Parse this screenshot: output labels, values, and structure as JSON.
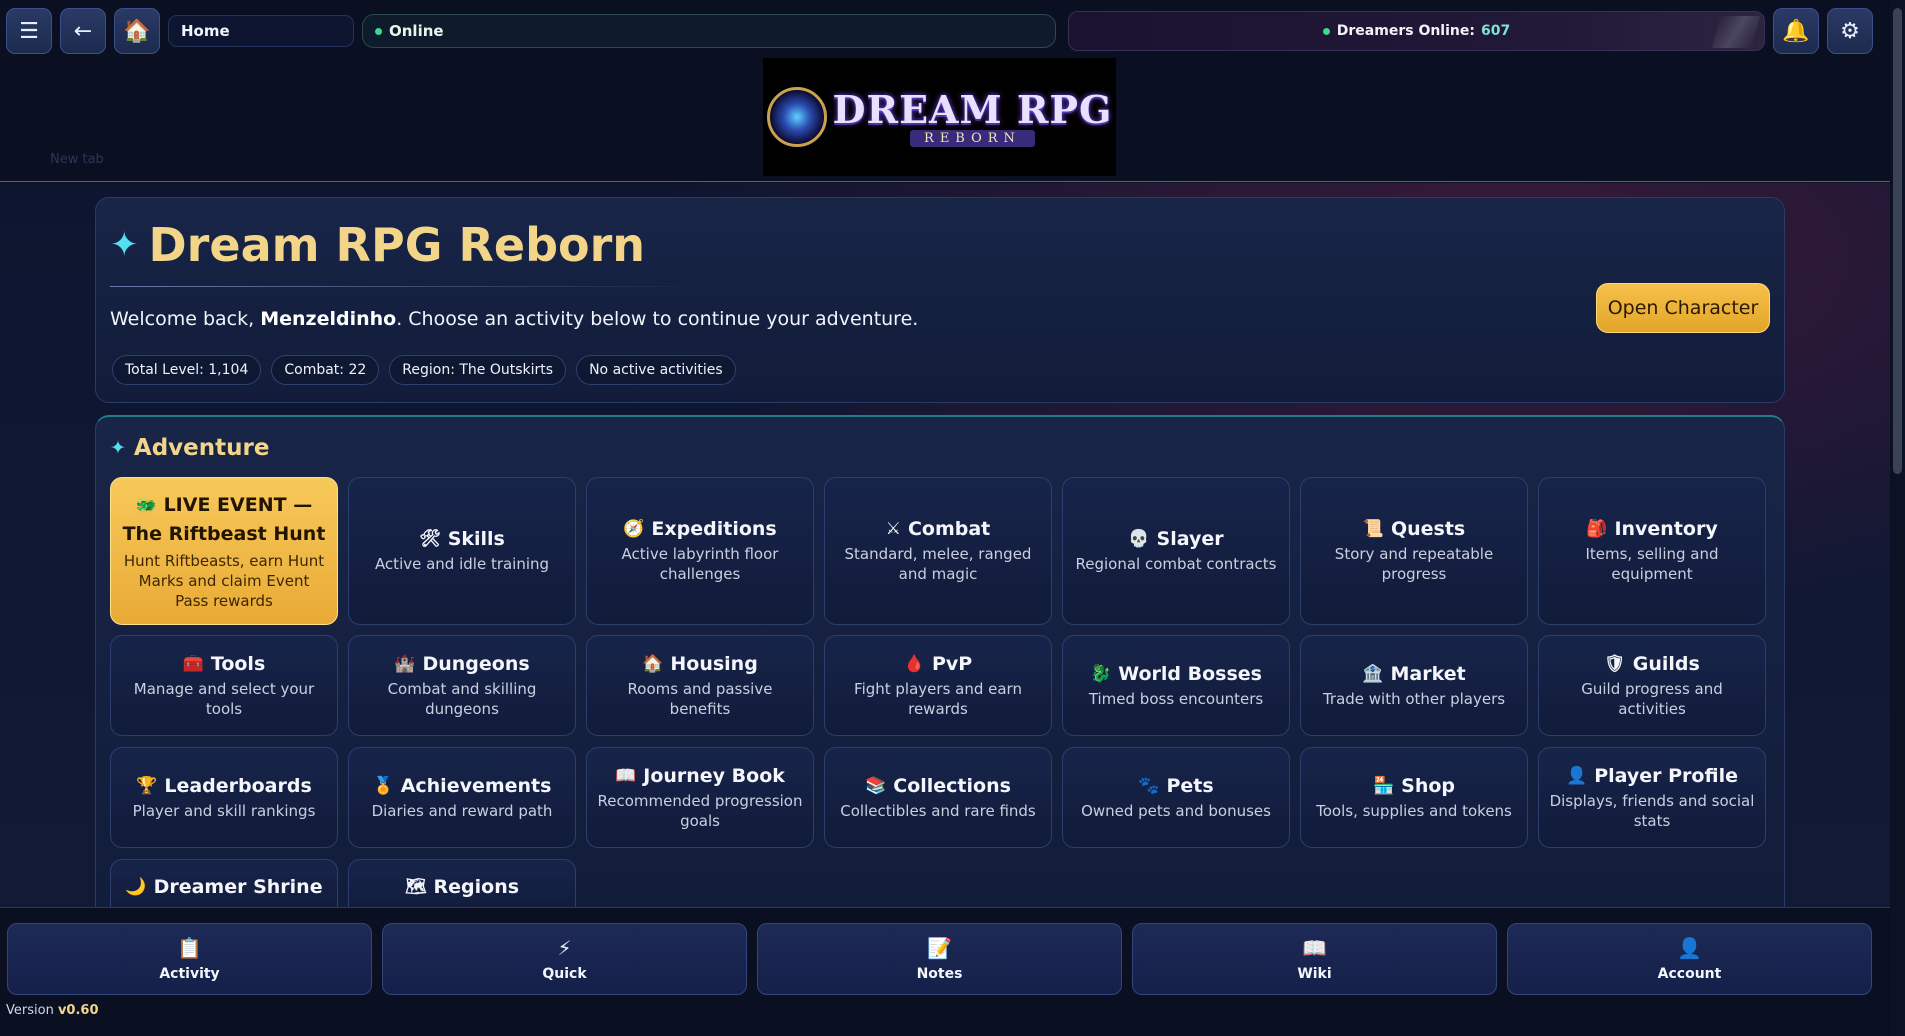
{
  "topbar": {
    "menu_icon": "☰",
    "back_icon": "←",
    "home_icon": "🏠",
    "breadcrumb": "Home",
    "status_label": "Online",
    "dreamers_label": "Dreamers Online:",
    "dreamers_count": "607",
    "bell_icon": "🔔",
    "settings_icon": "⚙"
  },
  "banner": {
    "logo_title": "DREAM RPG",
    "logo_subtitle": "REBORN",
    "ghost_tab": "New tab"
  },
  "hero": {
    "title": "Dream RPG Reborn",
    "star": "✦",
    "welcome_prefix": "Welcome back, ",
    "username": "Menzeldinho",
    "welcome_suffix": ". Choose an activity below to continue your adventure.",
    "tags": [
      "Total Level: 1,104",
      "Combat: 22",
      "Region: The Outskirts",
      "No active activities"
    ],
    "open_character_label": "Open Character"
  },
  "adventure": {
    "title": "Adventure",
    "star": "✦",
    "live_event": {
      "icon": "🐲",
      "title_line1": "LIVE EVENT —",
      "title_line2": "The Riftbeast Hunt",
      "desc": "Hunt Riftbeasts, earn Hunt Marks and claim Event Pass rewards"
    },
    "cards_row1": [
      {
        "icon": "🛠",
        "title": "Skills",
        "desc": "Active and idle training"
      },
      {
        "icon": "🧭",
        "title": "Expeditions",
        "desc": "Active labyrinth floor challenges"
      },
      {
        "icon": "⚔",
        "title": "Combat",
        "desc": "Standard, melee, ranged and magic"
      },
      {
        "icon": "💀",
        "title": "Slayer",
        "desc": "Regional combat contracts"
      },
      {
        "icon": "📜",
        "title": "Quests",
        "desc": "Story and repeatable progress"
      },
      {
        "icon": "🎒",
        "title": "Inventory",
        "desc": "Items, selling and equipment"
      }
    ],
    "cards_row2": [
      {
        "icon": "🧰",
        "title": "Tools",
        "desc": "Manage and select your tools"
      },
      {
        "icon": "🏰",
        "title": "Dungeons",
        "desc": "Combat and skilling dungeons"
      },
      {
        "icon": "🏠",
        "title": "Housing",
        "desc": "Rooms and passive benefits"
      },
      {
        "icon": "🩸",
        "title": "PvP",
        "desc": "Fight players and earn rewards"
      },
      {
        "icon": "🐉",
        "title": "World Bosses",
        "desc": "Timed boss encounters"
      },
      {
        "icon": "🏦",
        "title": "Market",
        "desc": "Trade with other players"
      },
      {
        "icon": "🛡",
        "title": "Guilds",
        "desc": "Guild progress and activities"
      }
    ],
    "cards_row3": [
      {
        "icon": "🏆",
        "title": "Leaderboards",
        "desc": "Player and skill rankings"
      },
      {
        "icon": "🏅",
        "title": "Achievements",
        "desc": "Diaries and reward path"
      },
      {
        "icon": "📖",
        "title": "Journey Book",
        "desc": "Recommended progression goals"
      },
      {
        "icon": "📚",
        "title": "Collections",
        "desc": "Collectibles and rare finds"
      },
      {
        "icon": "🐾",
        "title": "Pets",
        "desc": "Owned pets and bonuses"
      },
      {
        "icon": "🏪",
        "title": "Shop",
        "desc": "Tools, supplies and tokens"
      },
      {
        "icon": "👤",
        "title": "Player Profile",
        "desc": "Displays, friends and social stats"
      }
    ],
    "cards_row4": [
      {
        "icon": "🌙",
        "title": "Dreamer Shrine"
      },
      {
        "icon": "🗺",
        "title": "Regions"
      }
    ]
  },
  "bottom_nav": [
    {
      "icon": "📋",
      "label": "Activity"
    },
    {
      "icon": "⚡",
      "label": "Quick"
    },
    {
      "icon": "📝",
      "label": "Notes"
    },
    {
      "icon": "📖",
      "label": "Wiki"
    },
    {
      "icon": "👤",
      "label": "Account"
    }
  ],
  "version": {
    "label": "Version",
    "value": "v0.60"
  },
  "colors": {
    "accent_gold": "#f3d58a",
    "accent_cyan": "#54e0f0",
    "online_green": "#39d98a"
  }
}
